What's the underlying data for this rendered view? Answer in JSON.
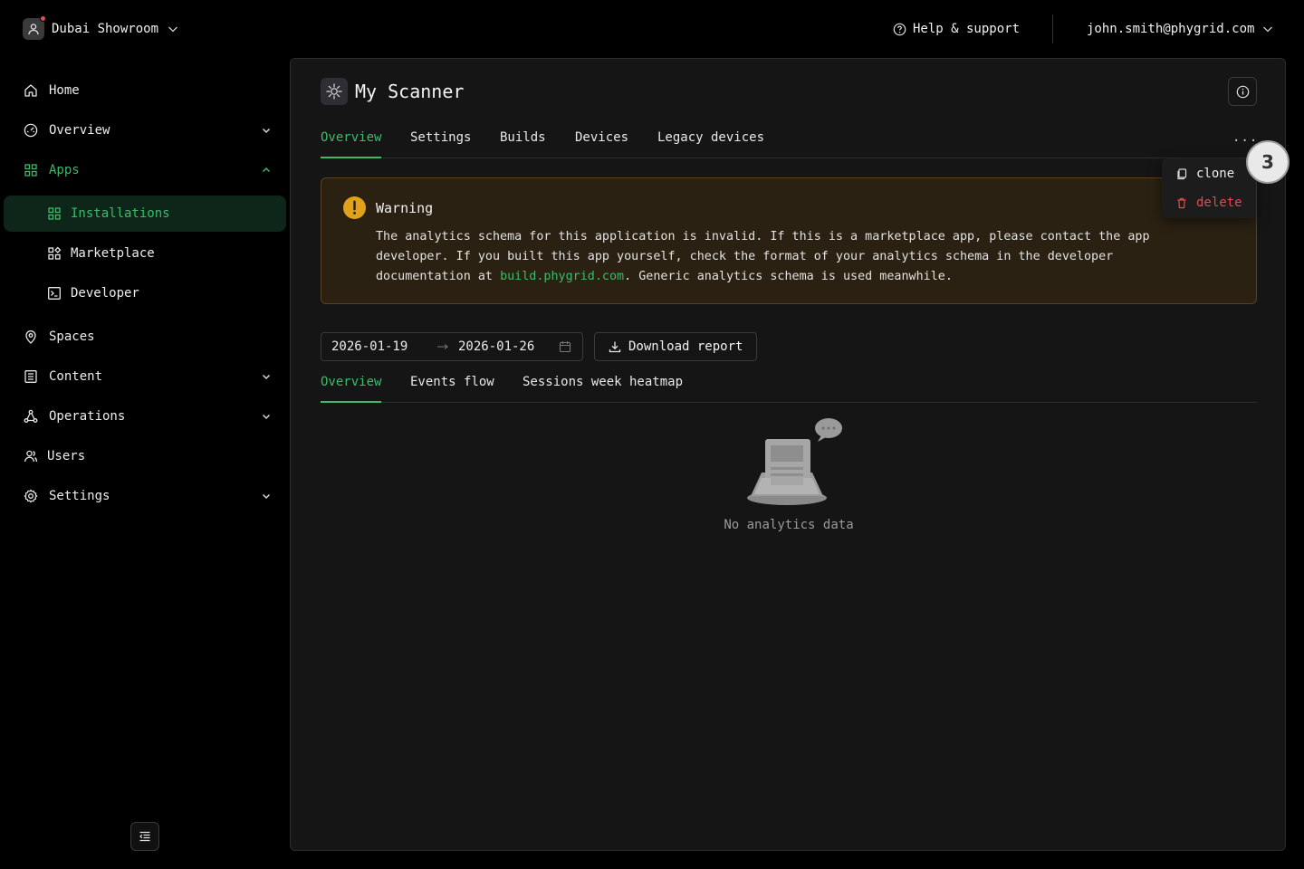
{
  "topbar": {
    "org_name": "Dubai Showroom",
    "help_label": "Help & support",
    "user_email": "john.smith@phygrid.com"
  },
  "sidebar": {
    "items": [
      {
        "label": "Home",
        "icon": "home-icon"
      },
      {
        "label": "Overview",
        "icon": "dashboard-icon"
      },
      {
        "label": "Apps",
        "icon": "apps-grid-icon"
      },
      {
        "label": "Installations",
        "icon": "grid-icon"
      },
      {
        "label": "Marketplace",
        "icon": "marketplace-icon"
      },
      {
        "label": "Developer",
        "icon": "terminal-icon"
      },
      {
        "label": "Spaces",
        "icon": "location-pin-icon"
      },
      {
        "label": "Content",
        "icon": "content-list-icon"
      },
      {
        "label": "Operations",
        "icon": "nodes-icon"
      },
      {
        "label": "Users",
        "icon": "users-icon"
      },
      {
        "label": "Settings",
        "icon": "gear-icon"
      }
    ]
  },
  "app": {
    "title": "My Scanner",
    "tabs": [
      "Overview",
      "Settings",
      "Builds",
      "Devices",
      "Legacy devices"
    ],
    "more_label": "...",
    "menu": {
      "clone_label": "clone",
      "delete_label": "delete"
    }
  },
  "warning": {
    "title": "Warning",
    "text_before_link": "The analytics schema for this application is invalid. If this is a marketplace app, please contact the app developer. If you built this app yourself, check the format of your analytics schema in the developer documentation at ",
    "link": "build.phygrid.com",
    "text_after_link": ". Generic analytics schema is used meanwhile."
  },
  "analytics": {
    "date_start": "2026-01-19",
    "date_end": "2026-01-26",
    "download_label": "Download report",
    "tabs": [
      "Overview",
      "Events flow",
      "Sessions week heatmap"
    ],
    "empty_text": "No analytics data"
  },
  "step_badge": "3",
  "colors": {
    "accent": "#3dba6a",
    "danger": "#e5484d",
    "warning": "#e0a21c",
    "panel_bg": "#151515"
  }
}
